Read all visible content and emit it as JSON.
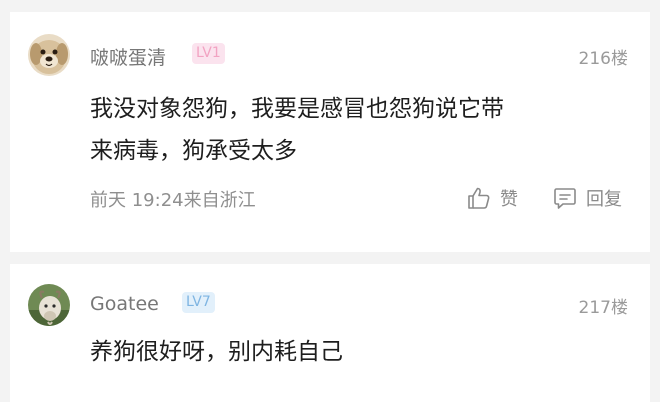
{
  "comments": [
    {
      "username": "啵啵蛋清",
      "level": "LV1",
      "floor": "216楼",
      "text_lines": [
        "我没对象怨狗，我要是感冒也怨狗说它带",
        "来病毒，狗承受太多"
      ],
      "time": "前天 19:24",
      "location": "来自浙江",
      "like_label": "赞",
      "reply_label": "回复",
      "avatar_icon": "dog-avatar-icon",
      "badge_color": "#f2a3c2"
    },
    {
      "username": "Goatee",
      "level": "LV7",
      "floor": "217楼",
      "text_lines": [
        "养狗很好呀，别内耗自己"
      ],
      "avatar_icon": "goat-avatar-icon",
      "badge_color": "#7fb5e2"
    }
  ]
}
